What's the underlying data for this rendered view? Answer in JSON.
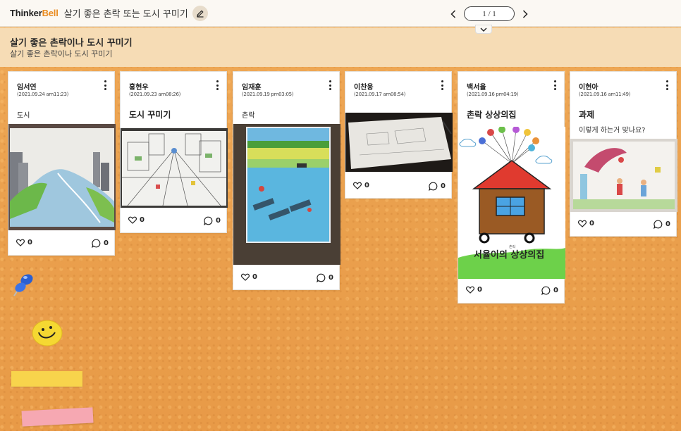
{
  "app": {
    "logo_thinker": "Thinker",
    "logo_bell": "Bell",
    "board_title": "살기 좋은 촌락 또는 도시 꾸미기"
  },
  "pager": {
    "label": "1 / 1"
  },
  "header": {
    "title": "살기 좋은 촌락이나 도시 꾸미기",
    "subtitle": "살기 좋은 촌락이나 도시 꾸미기"
  },
  "cards": [
    {
      "author": "임서연",
      "date": "(2021.09.24 am11:23)",
      "title": "도시",
      "title_bold": false,
      "body": "",
      "likes": "0",
      "comments": "0",
      "image": "city-drawing"
    },
    {
      "author": "홍현우",
      "date": "(2021.09.23 am08:26)",
      "title": "도시 꾸미기",
      "title_bold": true,
      "body": "",
      "likes": "0",
      "comments": "0",
      "image": "city-sketch"
    },
    {
      "author": "임재훈",
      "date": "(2021.09.19 pm03:05)",
      "title": "촌락",
      "title_bold": false,
      "body": "",
      "likes": "0",
      "comments": "0",
      "image": "village-drawing"
    },
    {
      "author": "이찬웅",
      "date": "(2021.09.17 am08:54)",
      "title": "",
      "title_bold": false,
      "body": "",
      "likes": "0",
      "comments": "0",
      "image": "paper-photo"
    },
    {
      "author": "백서율",
      "date": "(2021.09.16 pm04:19)",
      "title": "촌락 상상의집",
      "title_bold": true,
      "body": "",
      "likes": "0",
      "comments": "0",
      "image": "balloon-house",
      "image_caption": "서율이의 상상의집",
      "image_caption_small": "촌락"
    },
    {
      "author": "이현아",
      "date": "(2021.09.16 am11:49)",
      "title": "과제",
      "title_bold": true,
      "body": "이렇게 하는거 맞나요?",
      "likes": "0",
      "comments": "0",
      "image": "kids-drawing"
    }
  ],
  "colors": {
    "board": "#eaa04d",
    "header_band": "#f6dcb5",
    "accent": "#e98a1e"
  }
}
